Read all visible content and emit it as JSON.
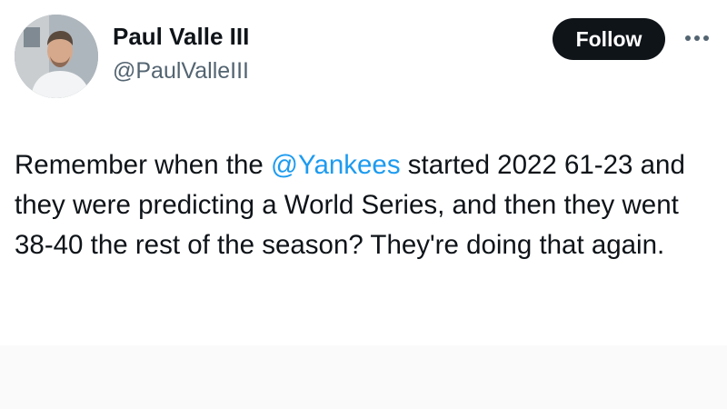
{
  "author": {
    "display_name": "Paul Valle III",
    "handle": "@PaulValleIII"
  },
  "follow_label": "Follow",
  "more_icon": "more-horizontal-icon",
  "tweet": {
    "text_before_mention": "Remember when the ",
    "mention": "@Yankees",
    "text_after_mention": " started 2022 61-23 and they were predicting a World Series, and then they went 38-40 the rest of the season? They're doing that again."
  },
  "colors": {
    "mention": "#1d9bf0",
    "follow_bg": "#0f1419",
    "handle": "#536471"
  }
}
